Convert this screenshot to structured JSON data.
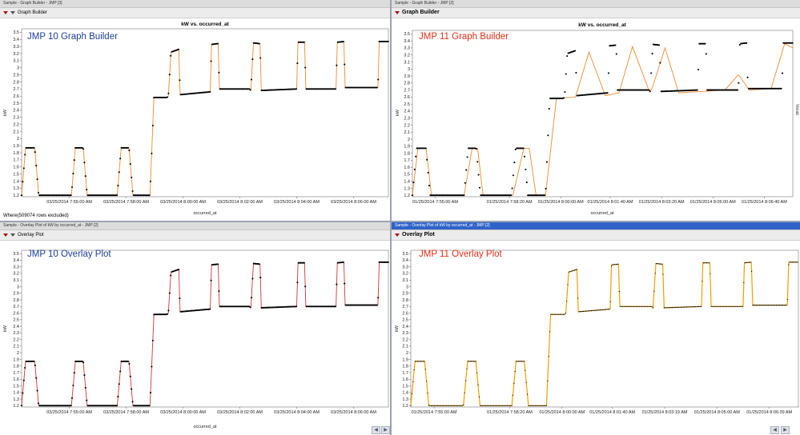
{
  "windows": {
    "tl": {
      "titlebar": "Sample - Graph Builder - JMP [3]",
      "panel": "Graph Builder",
      "chart_title": "kW vs. occurred_at",
      "overlay": "JMP 10 Graph Builder",
      "ylabel": "kW",
      "xlabel": "occurred_at",
      "note": "Where(509074 rows excluded)"
    },
    "tr": {
      "titlebar": "Sample - Graph Builder - JMP [2]",
      "panel": "Graph Builder",
      "chart_title": "kW vs. occurred_at",
      "overlay": "JMP 11 Graph Builder",
      "ylabel": "kW",
      "xlabel": "occurred_at",
      "side": "Variab"
    },
    "bl": {
      "titlebar": "Sample - Overlay Plot of kW by occurred_at - JMP [2]",
      "panel": "Overlay Plot",
      "overlay": "JMP 10 Overlay Plot",
      "ylabel": "kW",
      "xlabel": "occurred_at"
    },
    "br": {
      "titlebar": "Sample - Overlay Plot of kW by occurred_at - JMP [2]",
      "panel": "Overlay Plot",
      "overlay": "JMP 11 Overlay Plot",
      "ylabel": "kW"
    }
  },
  "colors": {
    "jmp10_title": "#1f3f99",
    "jmp11_title": "#e03018",
    "gb_line": "#f28a2f",
    "ov10_line": "#d03838",
    "ov11_line": "#f0a000",
    "points": "#000000"
  },
  "chart_data": [
    {
      "type": "line",
      "title": "kW vs. occurred_at",
      "xlabel": "occurred_at",
      "ylabel": "kW",
      "ylim": [
        1.18,
        3.55
      ],
      "yticks": [
        1.2,
        1.3,
        1.4,
        1.5,
        1.6,
        1.7,
        1.8,
        1.9,
        2,
        2.1,
        2.2,
        2.3,
        2.4,
        2.5,
        2.6,
        2.7,
        2.8,
        2.9,
        3,
        3.1,
        3.2,
        3.3,
        3.4,
        3.5
      ],
      "xticks": [
        {
          "t": 0.13,
          "label": "03/25/2014 7:55:00 AM"
        },
        {
          "t": 0.285,
          "label": "03/25/2014 7:58:00 AM"
        },
        {
          "t": 0.44,
          "label": "03/25/2014 8:00:00 AM"
        },
        {
          "t": 0.595,
          "label": "03/25/2014 8:02:00 AM"
        },
        {
          "t": 0.75,
          "label": "03/25/2014 8:04:00 AM"
        },
        {
          "t": 0.905,
          "label": "03/25/2014 8:06:00 AM"
        }
      ],
      "series": [
        {
          "values": [
            [
              0.0,
              1.2
            ],
            [
              0.015,
              1.87
            ],
            [
              0.05,
              1.87
            ],
            [
              0.065,
              1.2
            ],
            [
              0.19,
              1.2
            ],
            [
              0.205,
              1.87
            ],
            [
              0.235,
              1.87
            ],
            [
              0.25,
              1.2
            ],
            [
              0.365,
              1.2
            ],
            [
              0.38,
              1.87
            ],
            [
              0.41,
              1.87
            ],
            [
              0.425,
              1.2
            ],
            [
              0.49,
              1.2
            ],
            [
              0.505,
              2.58
            ],
            [
              0.555,
              2.58
            ],
            [
              0.56,
              2.6
            ],
            [
              0.57,
              3.22
            ],
            [
              0.6,
              3.26
            ],
            [
              0.605,
              2.62
            ],
            [
              0.72,
              2.66
            ],
            [
              0.725,
              3.33
            ],
            [
              0.75,
              3.34
            ],
            [
              0.755,
              2.7
            ],
            [
              0.87,
              2.7
            ],
            [
              0.875,
              2.68
            ],
            [
              0.885,
              3.35
            ],
            [
              0.91,
              3.34
            ],
            [
              0.915,
              2.68
            ],
            [
              1.05,
              2.7
            ],
            [
              1.055,
              3.36
            ],
            [
              1.08,
              3.36
            ],
            [
              1.085,
              2.7
            ],
            [
              1.2,
              2.7
            ],
            [
              1.205,
              3.36
            ],
            [
              1.23,
              3.37
            ],
            [
              1.235,
              2.72
            ],
            [
              1.36,
              2.72
            ],
            [
              1.365,
              3.37
            ],
            [
              1.4,
              3.37
            ]
          ]
        }
      ]
    },
    {
      "type": "line",
      "title": "kW vs. occurred_at",
      "xlabel": "occurred_at",
      "ylabel": "kW",
      "ylim": [
        1.18,
        3.55
      ],
      "yticks": [
        1.2,
        1.3,
        1.4,
        1.5,
        1.6,
        1.7,
        1.8,
        1.9,
        2,
        2.1,
        2.2,
        2.3,
        2.4,
        2.5,
        2.6,
        2.7,
        2.8,
        2.9,
        3,
        3.1,
        3.2,
        3.3,
        3.4,
        3.5
      ],
      "xticks": [
        {
          "t": 0.06,
          "label": "01/25/2014 7:55:00 AM"
        },
        {
          "t": 0.255,
          "label": "01/25/2014 7:58:20 AM"
        },
        {
          "t": 0.39,
          "label": "01/25/2014 8:00:00 AM"
        },
        {
          "t": 0.52,
          "label": "01/25/2014 8:01:40 AM"
        },
        {
          "t": 0.655,
          "label": "01/25/2014 8:03:20 AM"
        },
        {
          "t": 0.79,
          "label": "01/25/2014 8:05:00 AM"
        },
        {
          "t": 0.925,
          "label": "01/25/2014 8:06:40 AM"
        }
      ],
      "series": [
        {
          "values": [
            [
              0.0,
              1.2
            ],
            [
              0.02,
              1.87
            ],
            [
              0.05,
              1.87
            ],
            [
              0.07,
              1.2
            ],
            [
              0.19,
              1.2
            ],
            [
              0.22,
              1.87
            ],
            [
              0.24,
              1.87
            ],
            [
              0.26,
              1.2
            ],
            [
              0.37,
              1.2
            ],
            [
              0.41,
              1.87
            ],
            [
              0.43,
              1.87
            ],
            [
              0.455,
              1.2
            ],
            [
              0.49,
              1.2
            ],
            [
              0.53,
              2.58
            ],
            [
              0.6,
              2.6
            ],
            [
              0.65,
              3.24
            ],
            [
              0.71,
              2.62
            ],
            [
              0.76,
              2.66
            ],
            [
              0.81,
              3.32
            ],
            [
              0.87,
              2.7
            ],
            [
              0.88,
              2.7
            ],
            [
              0.93,
              3.3
            ],
            [
              0.98,
              2.66
            ],
            [
              1.15,
              2.7
            ],
            [
              1.2,
              2.92
            ],
            [
              1.24,
              2.7
            ],
            [
              1.32,
              2.72
            ],
            [
              1.37,
              3.36
            ],
            [
              1.4,
              3.3
            ]
          ]
        }
      ]
    },
    {
      "type": "line",
      "title": "",
      "xlabel": "occurred_at",
      "ylabel": "kW",
      "ylim": [
        1.18,
        3.55
      ],
      "yticks": [
        1.2,
        1.3,
        1.4,
        1.5,
        1.6,
        1.7,
        1.8,
        1.9,
        2,
        2.1,
        2.2,
        2.3,
        2.4,
        2.5,
        2.6,
        2.7,
        2.8,
        2.9,
        3,
        3.1,
        3.2,
        3.3,
        3.4,
        3.5
      ],
      "xticks": [
        {
          "t": 0.13,
          "label": "03/25/2014 7:55:00 AM"
        },
        {
          "t": 0.285,
          "label": "03/25/2014 7:58:00 AM"
        },
        {
          "t": 0.44,
          "label": "03/25/2014 8:00:00 AM"
        },
        {
          "t": 0.595,
          "label": "03/25/2014 8:02:00 AM"
        },
        {
          "t": 0.75,
          "label": "03/25/2014 8:04:00 AM"
        },
        {
          "t": 0.905,
          "label": "03/25/2014 8:06:00 AM"
        }
      ],
      "series": [
        {
          "values": [
            [
              0.0,
              1.2
            ],
            [
              0.015,
              1.87
            ],
            [
              0.05,
              1.87
            ],
            [
              0.065,
              1.2
            ],
            [
              0.19,
              1.2
            ],
            [
              0.205,
              1.87
            ],
            [
              0.235,
              1.87
            ],
            [
              0.25,
              1.2
            ],
            [
              0.365,
              1.2
            ],
            [
              0.38,
              1.87
            ],
            [
              0.41,
              1.87
            ],
            [
              0.425,
              1.2
            ],
            [
              0.49,
              1.2
            ],
            [
              0.505,
              2.58
            ],
            [
              0.555,
              2.58
            ],
            [
              0.56,
              2.6
            ],
            [
              0.57,
              3.22
            ],
            [
              0.6,
              3.26
            ],
            [
              0.605,
              2.62
            ],
            [
              0.72,
              2.66
            ],
            [
              0.725,
              3.33
            ],
            [
              0.75,
              3.34
            ],
            [
              0.755,
              2.7
            ],
            [
              0.87,
              2.7
            ],
            [
              0.875,
              2.68
            ],
            [
              0.885,
              3.35
            ],
            [
              0.91,
              3.34
            ],
            [
              0.915,
              2.68
            ],
            [
              1.05,
              2.7
            ],
            [
              1.055,
              3.36
            ],
            [
              1.08,
              3.36
            ],
            [
              1.085,
              2.7
            ],
            [
              1.2,
              2.7
            ],
            [
              1.205,
              3.36
            ],
            [
              1.23,
              3.37
            ],
            [
              1.235,
              2.72
            ],
            [
              1.36,
              2.72
            ],
            [
              1.365,
              3.37
            ],
            [
              1.4,
              3.37
            ]
          ]
        }
      ]
    },
    {
      "type": "line",
      "title": "",
      "xlabel": "",
      "ylabel": "kW",
      "ylim": [
        1.18,
        3.55
      ],
      "yticks": [
        1.2,
        1.3,
        1.4,
        1.5,
        1.6,
        1.7,
        1.8,
        1.9,
        2,
        2.1,
        2.2,
        2.3,
        2.4,
        2.5,
        2.6,
        2.7,
        2.8,
        2.9,
        3,
        3.1,
        3.2,
        3.3,
        3.4,
        3.5
      ],
      "xticks": [
        {
          "t": 0.06,
          "label": "01/25/2014 7:55:00 AM"
        },
        {
          "t": 0.255,
          "label": "01/25/2014 7:58:20 AM"
        },
        {
          "t": 0.39,
          "label": "01/25/2014 8:00:00 AM"
        },
        {
          "t": 0.52,
          "label": "01/25/2014 8:01:40 AM"
        },
        {
          "t": 0.655,
          "label": "01/25/2014 8:03:19 AM"
        },
        {
          "t": 0.79,
          "label": "01/25/2014 8:05:00 AM"
        },
        {
          "t": 0.925,
          "label": "01/25/2014 8:06:39 AM"
        }
      ],
      "series": [
        {
          "values": [
            [
              0.0,
              1.2
            ],
            [
              0.015,
              1.87
            ],
            [
              0.05,
              1.87
            ],
            [
              0.065,
              1.2
            ],
            [
              0.19,
              1.2
            ],
            [
              0.205,
              1.87
            ],
            [
              0.235,
              1.87
            ],
            [
              0.25,
              1.2
            ],
            [
              0.365,
              1.2
            ],
            [
              0.38,
              1.87
            ],
            [
              0.41,
              1.87
            ],
            [
              0.425,
              1.2
            ],
            [
              0.49,
              1.2
            ],
            [
              0.505,
              2.58
            ],
            [
              0.555,
              2.58
            ],
            [
              0.56,
              2.6
            ],
            [
              0.57,
              3.22
            ],
            [
              0.6,
              3.26
            ],
            [
              0.605,
              2.62
            ],
            [
              0.72,
              2.66
            ],
            [
              0.725,
              3.33
            ],
            [
              0.75,
              3.34
            ],
            [
              0.755,
              2.7
            ],
            [
              0.87,
              2.7
            ],
            [
              0.875,
              2.68
            ],
            [
              0.885,
              3.35
            ],
            [
              0.91,
              3.34
            ],
            [
              0.915,
              2.68
            ],
            [
              1.05,
              2.7
            ],
            [
              1.055,
              3.36
            ],
            [
              1.08,
              3.36
            ],
            [
              1.085,
              2.7
            ],
            [
              1.2,
              2.7
            ],
            [
              1.205,
              3.36
            ],
            [
              1.23,
              3.37
            ],
            [
              1.235,
              2.72
            ],
            [
              1.36,
              2.72
            ],
            [
              1.365,
              3.37
            ],
            [
              1.4,
              3.37
            ]
          ]
        }
      ]
    }
  ]
}
